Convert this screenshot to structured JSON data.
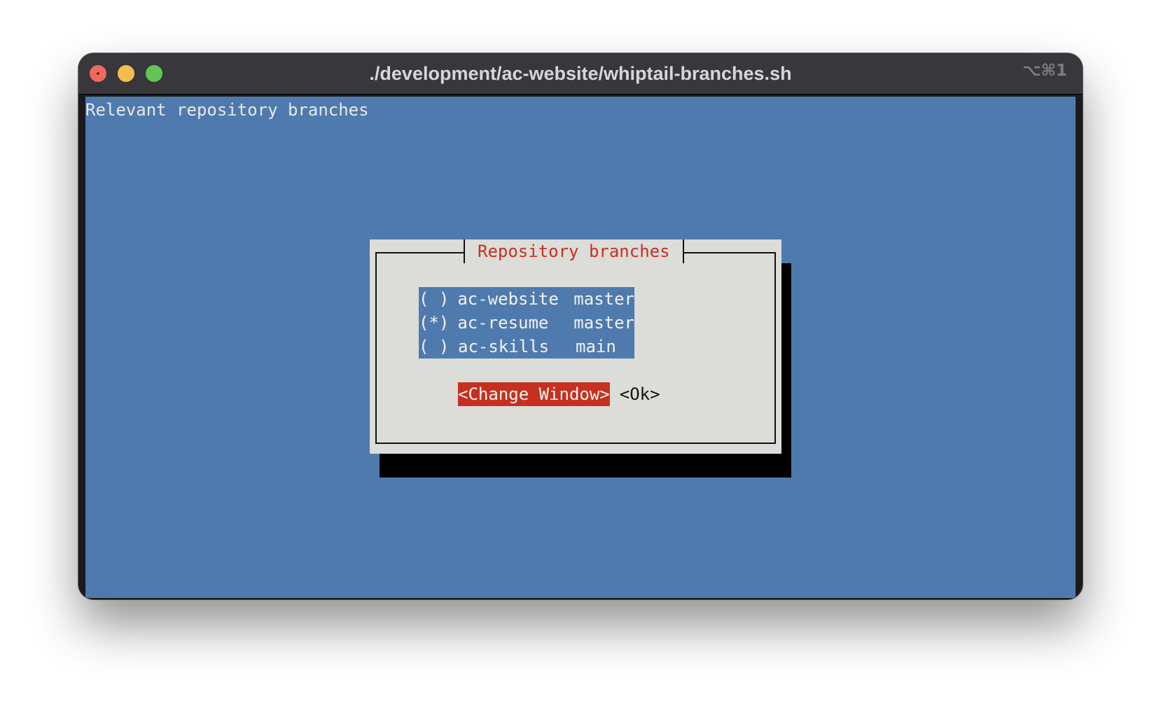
{
  "window": {
    "title": "./development/ac-website/whiptail-branches.sh",
    "shortcut": "⌥⌘1"
  },
  "terminal": {
    "backtitle": "Relevant repository branches",
    "dialog": {
      "title": "Repository branches",
      "items": [
        {
          "mark": "( )",
          "name": "ac-website",
          "branch": "master"
        },
        {
          "mark": "(*)",
          "name": "ac-resume",
          "branch": "master"
        },
        {
          "mark": "( )",
          "name": "ac-skills",
          "branch": "main"
        }
      ],
      "buttons": {
        "change_window": "<Change Window>",
        "ok": "<Ok>"
      }
    }
  },
  "colors": {
    "terminal_bg": "#4f7aad",
    "dialog_bg": "#dcdcd8",
    "accent_red": "#c7301f",
    "titlebar": "#38373b"
  }
}
